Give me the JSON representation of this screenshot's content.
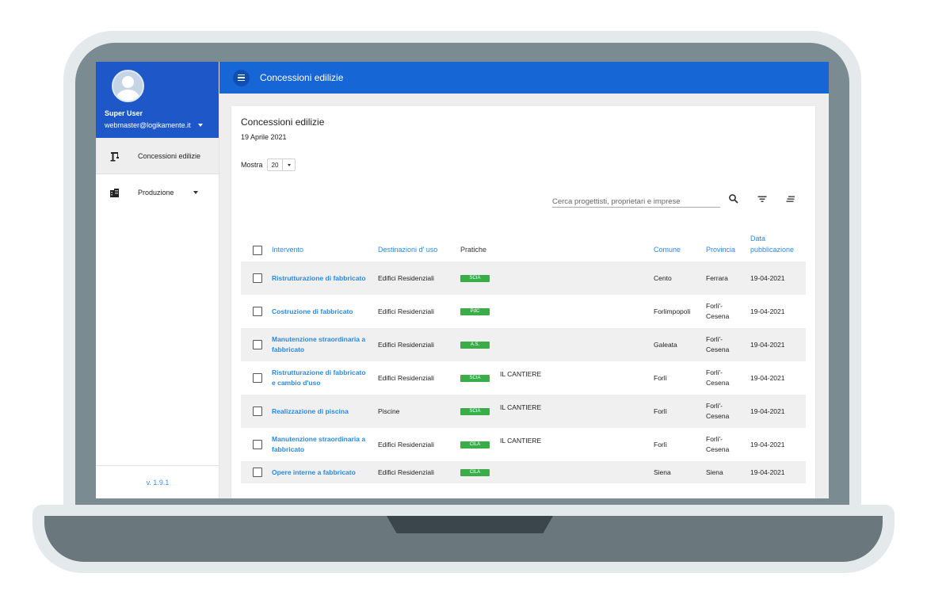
{
  "app": {
    "title": "Concessioni edilizie"
  },
  "sidebar": {
    "user_name": "Super User",
    "user_email": "webmaster@logikamente.it",
    "items": [
      {
        "label": "Concessioni edilizie",
        "icon": "crane-icon",
        "active": true
      },
      {
        "label": "Produzione",
        "icon": "buildings-icon",
        "active": false
      }
    ],
    "version": "v. 1.9.1"
  },
  "page": {
    "title": "Concessioni edilizie",
    "date": "19 Aprile 2021",
    "show_label": "Mostra",
    "page_size": "20",
    "search_placeholder": "Cerca progettisti, proprietari e imprese"
  },
  "table": {
    "headers": {
      "intervento": "Intervento",
      "destinazioni": "Destinazioni d' uso",
      "pratiche": "Pratiche",
      "comune": "Comune",
      "provincia": "Provincia",
      "data": "Data pubblicazione"
    },
    "rows": [
      {
        "intervento": "Ristrutturazione di fabbricato",
        "destinazione": "Edifici Residenziali",
        "pratica": "SCIA",
        "extra": "",
        "comune": "Cento",
        "provincia": "Ferrara",
        "data": "19-04-2021"
      },
      {
        "intervento": "Costruzione di fabbricato",
        "destinazione": "Edifici Residenziali",
        "pratica": "PdC",
        "extra": "",
        "comune": "Forlimpopoli",
        "provincia": "Forli'-Cesena",
        "data": "19-04-2021"
      },
      {
        "intervento": "Manutenzione straordinaria a fabbricato",
        "destinazione": "Edifici Residenziali",
        "pratica": "A.S.",
        "extra": "",
        "comune": "Galeata",
        "provincia": "Forli'-Cesena",
        "data": "19-04-2021"
      },
      {
        "intervento": "Ristrutturazione di fabbricato e cambio d'uso",
        "destinazione": "Edifici Residenziali",
        "pratica": "SCIA",
        "extra": "IL CANTIERE",
        "comune": "Forlì",
        "provincia": "Forli'-Cesena",
        "data": "19-04-2021"
      },
      {
        "intervento": "Realizzazione di piscina",
        "destinazione": "Piscine",
        "pratica": "SCIA",
        "extra": "IL CANTIERE",
        "comune": "Forlì",
        "provincia": "Forli'-Cesena",
        "data": "19-04-2021"
      },
      {
        "intervento": "Manutenzione straordinaria a fabbricato",
        "destinazione": "Edifici Residenziali",
        "pratica": "CILA",
        "extra": "IL CANTIERE",
        "comune": "Forlì",
        "provincia": "Forli'-Cesena",
        "data": "19-04-2021"
      },
      {
        "intervento": "Opere interne a fabbricato",
        "destinazione": "Edifici Residenziali",
        "pratica": "CILA",
        "extra": "",
        "comune": "Siena",
        "provincia": "Siena",
        "data": "19-04-2021"
      }
    ]
  },
  "colors": {
    "primary": "#1766d6",
    "sidebar_header": "#1e58c8",
    "link": "#2d88df",
    "badge": "#3aad49"
  }
}
